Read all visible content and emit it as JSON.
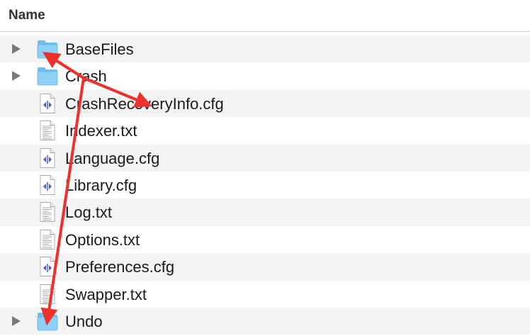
{
  "header": {
    "name_column": "Name"
  },
  "files": [
    {
      "name": "BaseFiles",
      "kind": "folder",
      "expandable": true
    },
    {
      "name": "Crash",
      "kind": "folder",
      "expandable": true
    },
    {
      "name": "CrashRecoveryInfo.cfg",
      "kind": "cfg",
      "expandable": false
    },
    {
      "name": "Indexer.txt",
      "kind": "txt",
      "expandable": false
    },
    {
      "name": "Language.cfg",
      "kind": "cfg",
      "expandable": false
    },
    {
      "name": "Library.cfg",
      "kind": "cfg",
      "expandable": false
    },
    {
      "name": "Log.txt",
      "kind": "txt",
      "expandable": false
    },
    {
      "name": "Options.txt",
      "kind": "txt",
      "expandable": false
    },
    {
      "name": "Preferences.cfg",
      "kind": "cfg",
      "expandable": false
    },
    {
      "name": "Swapper.txt",
      "kind": "txt",
      "expandable": false
    },
    {
      "name": "Undo",
      "kind": "folder",
      "expandable": true
    }
  ],
  "icons": {
    "folder": "folder-icon",
    "cfg": "config-file-icon",
    "txt": "text-file-icon",
    "disclosure": "disclosure-triangle-icon"
  },
  "colors": {
    "folder_body": "#8fd0f7",
    "folder_tab": "#6bbff2",
    "annotation_arrow": "#f0302a",
    "alt_row": "#f4f4f4"
  }
}
